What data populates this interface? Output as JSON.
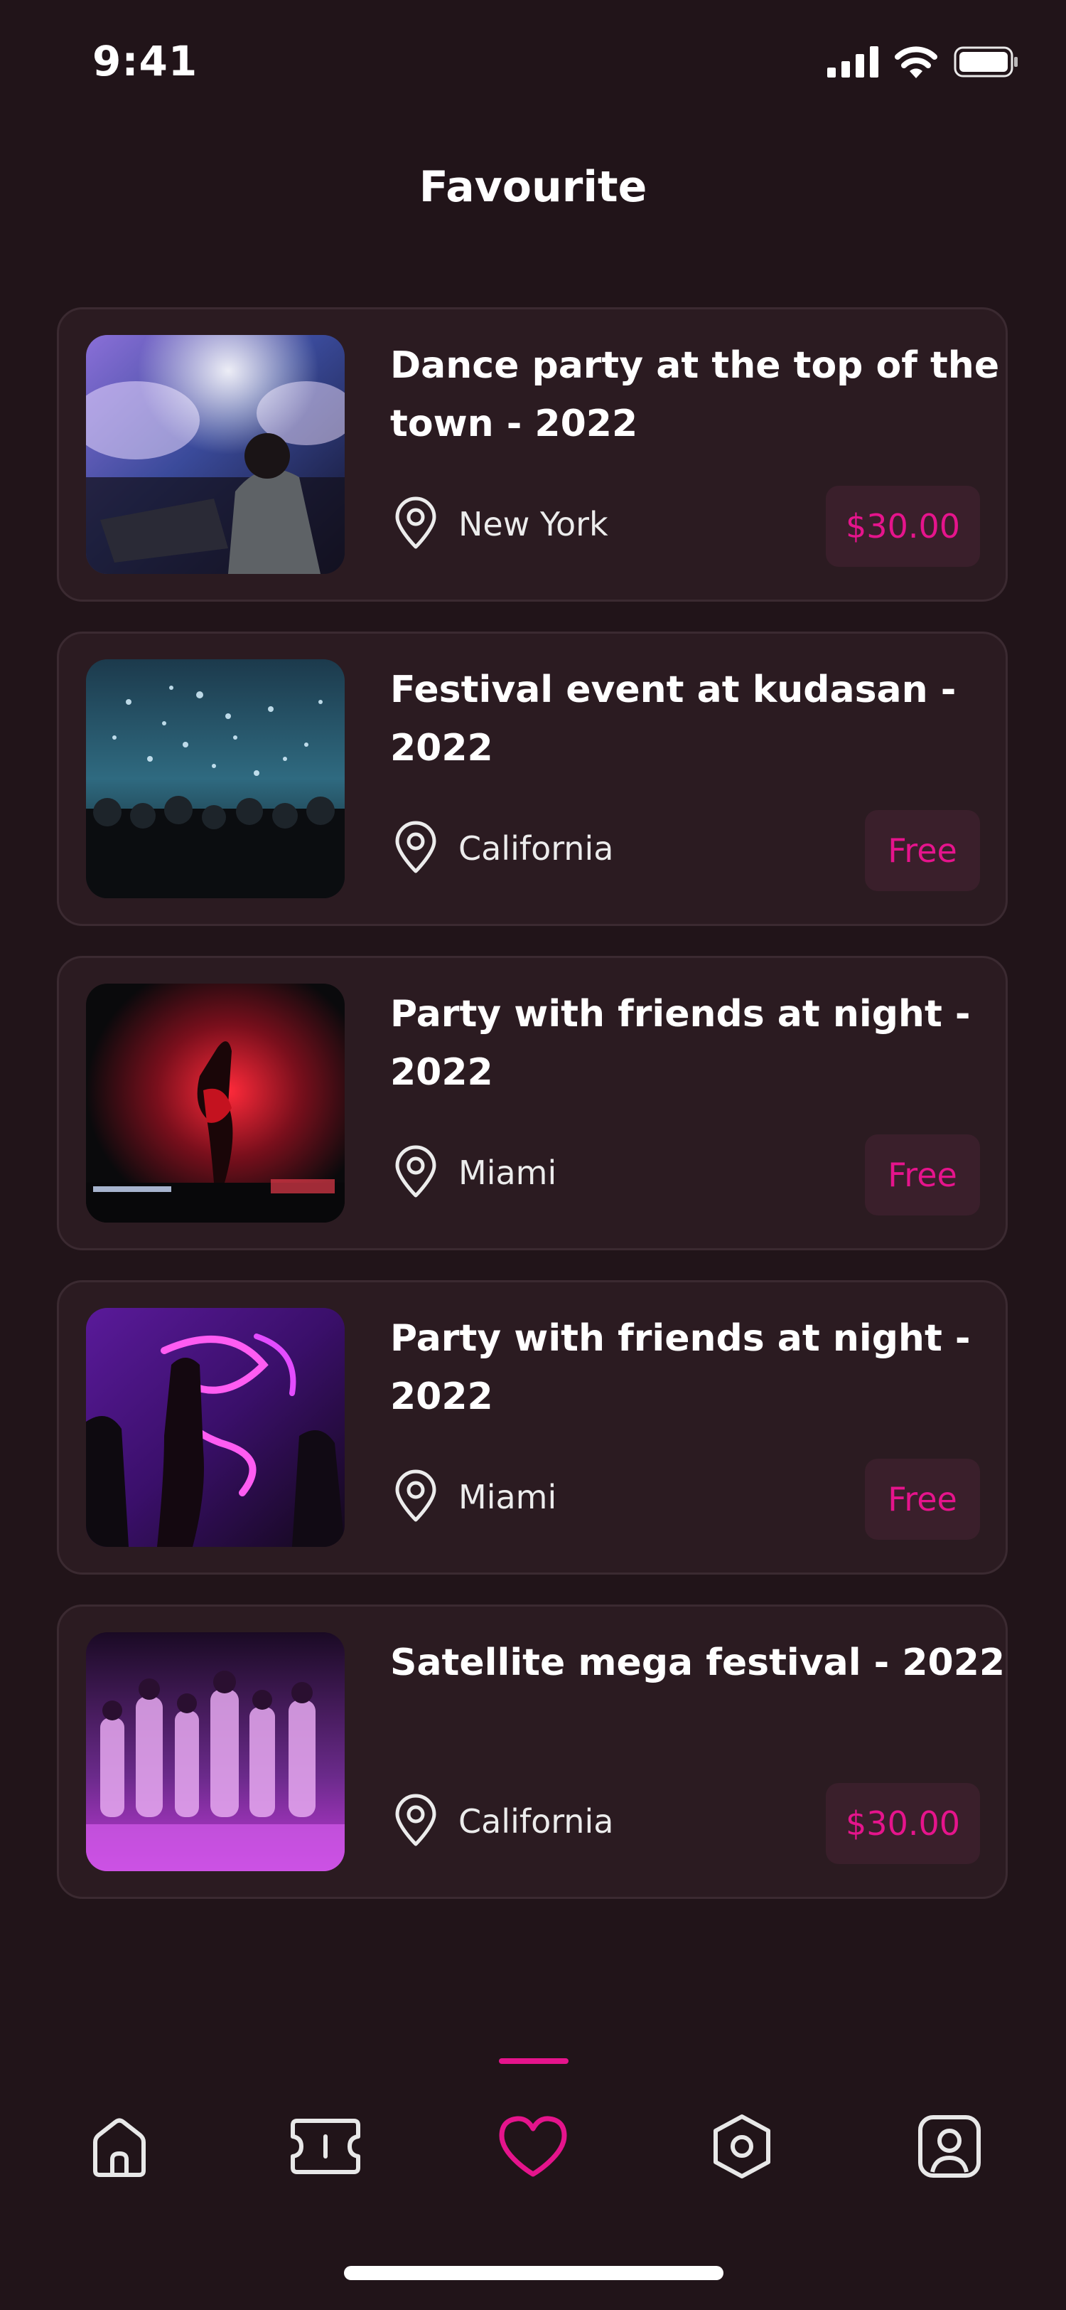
{
  "status_bar": {
    "time": "9:41",
    "icons": [
      "cellular-signal-icon",
      "wifi-icon",
      "battery-icon"
    ]
  },
  "header": {
    "title": "Favourite"
  },
  "favourites": [
    {
      "title": "Dance party at the top of the town - 2022",
      "location": "New York",
      "price": "$30.00",
      "image": "dj-performing-crowd-photo"
    },
    {
      "title": "Festival event at kudasan - 2022",
      "location": "California",
      "price": "Free",
      "image": "confetti-concert-crowd-photo"
    },
    {
      "title": "Party with friends at night - 2022",
      "location": "Miami",
      "price": "Free",
      "image": "dancer-red-light-stage-photo"
    },
    {
      "title": "Party with friends at night - 2022",
      "location": "Miami",
      "price": "Free",
      "image": "purple-neon-party-photo"
    },
    {
      "title": "Satellite mega festival - 2022",
      "location": "California",
      "price": "$30.00",
      "image": "dance-crew-purple-stage-photo"
    }
  ],
  "tab_bar": {
    "active": "favourite",
    "tabs": [
      "home-icon",
      "ticket-icon",
      "heart-icon",
      "explore-icon",
      "profile-icon"
    ]
  },
  "colors": {
    "background": "#211419",
    "card": "#2b1b21",
    "accent": "#e5148c",
    "price_badge": "#3a1f2b"
  }
}
